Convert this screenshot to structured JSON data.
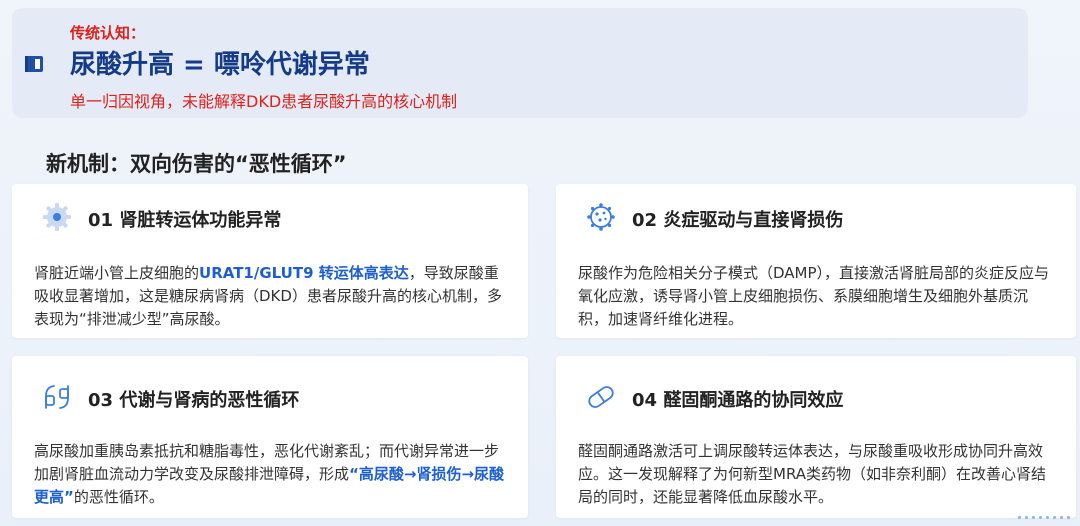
{
  "traditional": {
    "label": "传统认知：",
    "title": "尿酸升高 = 嘌呤代谢异常",
    "subtitle": "单一归因视角，未能解释DKD患者尿酸升高的核心机制"
  },
  "section_title": "新机制：双向伤害的“恶性循环”",
  "cards": [
    {
      "title": "01 肾脏转运体功能异常",
      "body_pre": "肾脏近端小管上皮细胞的",
      "body_hl": "URAT1/GLUT9 转运体高表达",
      "body_post": "，导致尿酸重吸收显著增加，这是糖尿病肾病（DKD）患者尿酸升高的核心机制，多表现为“排泄减少型”高尿酸。"
    },
    {
      "title": "02 炎症驱动与直接肾损伤",
      "body": "尿酸作为危险相关分子模式（DAMP），直接激活肾脏局部的炎症反应与氧化应激，诱导肾小管上皮细胞损伤、系膜细胞增生及细胞外基质沉积，加速肾纤维化进程。"
    },
    {
      "title": "03 代谢与肾病的恶性循环",
      "body_pre": "高尿酸加重胰岛素抵抗和糖脂毒性，恶化代谢紊乱；而代谢异常进一步加剧肾脏血流动力学改变及尿酸排泄障碍，形成",
      "body_hl": "“高尿酸→肾损伤→尿酸更高”",
      "body_post": "的恶性循环。"
    },
    {
      "title": "04 醛固酮通路的协同效应",
      "body": "醛固酮通路激活可上调尿酸转运体表达，与尿酸重吸收形成协同升高效应。这一发现解释了为何新型MRA类药物（如非奈利酮）在改善心肾结局的同时，还能显著降低血尿酸水平。"
    }
  ],
  "colors": {
    "accent_red": "#e0201b",
    "title_blue": "#143a8a",
    "highlight_blue": "#1d5fd1",
    "icon_blue": "#3b7de0"
  }
}
